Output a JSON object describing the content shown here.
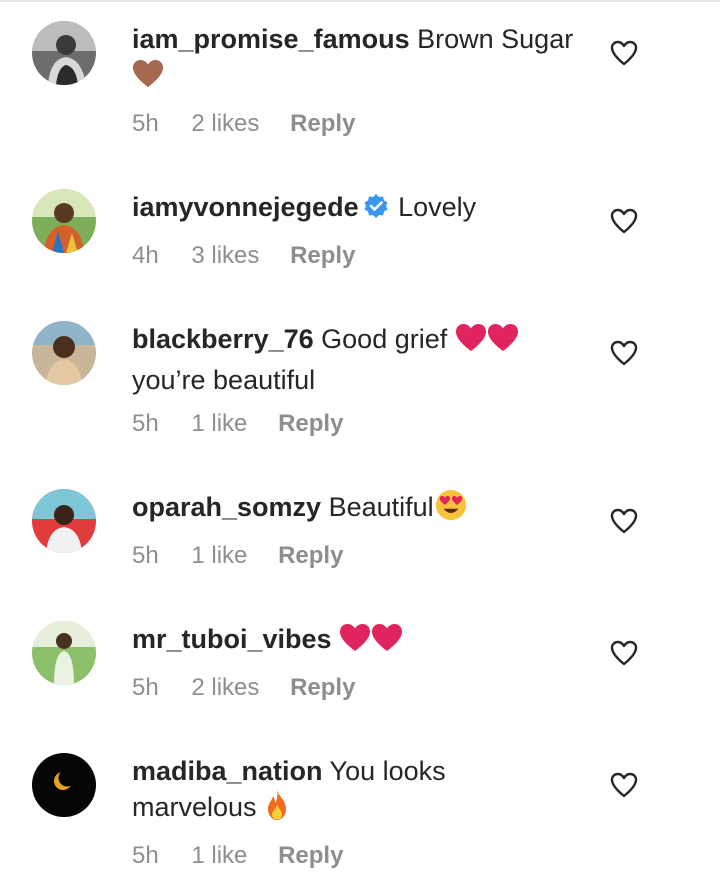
{
  "comments": [
    {
      "username": "iam_promise_famous",
      "text": "Brown Sugar",
      "emojis": [
        "brown-heart"
      ],
      "time": "5h",
      "likes": "2 likes",
      "reply": "Reply",
      "verified": false
    },
    {
      "username": "iamyvonnejegede",
      "text": "Lovely",
      "emojis": [],
      "time": "4h",
      "likes": "3 likes",
      "reply": "Reply",
      "verified": true
    },
    {
      "username": "blackberry_76",
      "text": "Good grief",
      "text_after": "you’re beautiful",
      "emojis": [
        "red-heart",
        "red-heart"
      ],
      "time": "5h",
      "likes": "1 like",
      "reply": "Reply",
      "verified": false
    },
    {
      "username": "oparah_somzy",
      "text": "Beautiful",
      "emojis": [
        "heart-eyes"
      ],
      "time": "5h",
      "likes": "1 like",
      "reply": "Reply",
      "verified": false
    },
    {
      "username": "mr_tuboi_vibes",
      "text": "",
      "emojis": [
        "red-heart",
        "red-heart"
      ],
      "time": "5h",
      "likes": "2 likes",
      "reply": "Reply",
      "verified": false
    },
    {
      "username": "madiba_nation",
      "text": "You looks marvelous",
      "emojis": [
        "fire"
      ],
      "time": "5h",
      "likes": "1 like",
      "reply": "Reply",
      "verified": false
    }
  ],
  "colors": {
    "text": "#262626",
    "meta": "#8e8e8e",
    "verified": "#3897f0",
    "red_heart": "#e0245e",
    "brown_heart": "#a5694f"
  },
  "icons": {
    "like": "heart-outline-icon",
    "verified": "verified-badge-icon"
  }
}
